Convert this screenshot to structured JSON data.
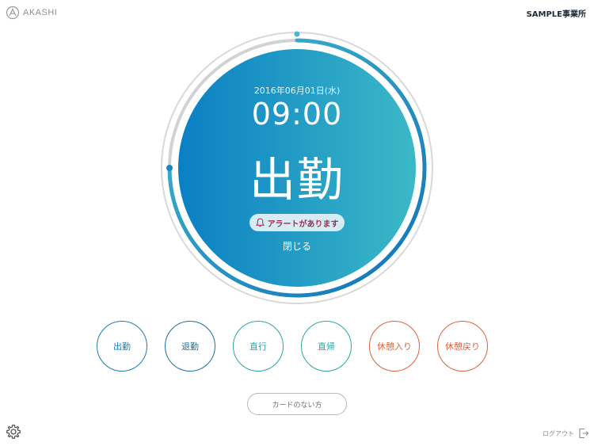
{
  "header": {
    "brand": "AKASHI",
    "office": "SAMPLE事業所"
  },
  "clock": {
    "date": "2016年06月01日(水)",
    "time": "09:00",
    "status": "出勤",
    "alert_label": "アラートがあります",
    "close_label": "閉じる"
  },
  "actions": [
    {
      "label": "出勤",
      "color": "#1a7fb0"
    },
    {
      "label": "退勤",
      "color": "#1c6fa3"
    },
    {
      "label": "直行",
      "color": "#2aa6a4"
    },
    {
      "label": "直帰",
      "color": "#2aa6a4"
    },
    {
      "label": "休憩入り",
      "color": "#d9633f"
    },
    {
      "label": "休憩戻り",
      "color": "#d9633f"
    }
  ],
  "no_card_label": "カードのない方",
  "footer": {
    "logout_label": "ログアウト"
  },
  "colors": {
    "gradient_start": "#0a7fc4",
    "gradient_end": "#3bb9c6",
    "progress_arc": "#2196c9",
    "track": "#d2d2d2"
  },
  "icons": {
    "brand": "akashi-logo-icon",
    "alert": "bell-icon",
    "settings": "gear-icon",
    "logout": "logout-icon"
  }
}
